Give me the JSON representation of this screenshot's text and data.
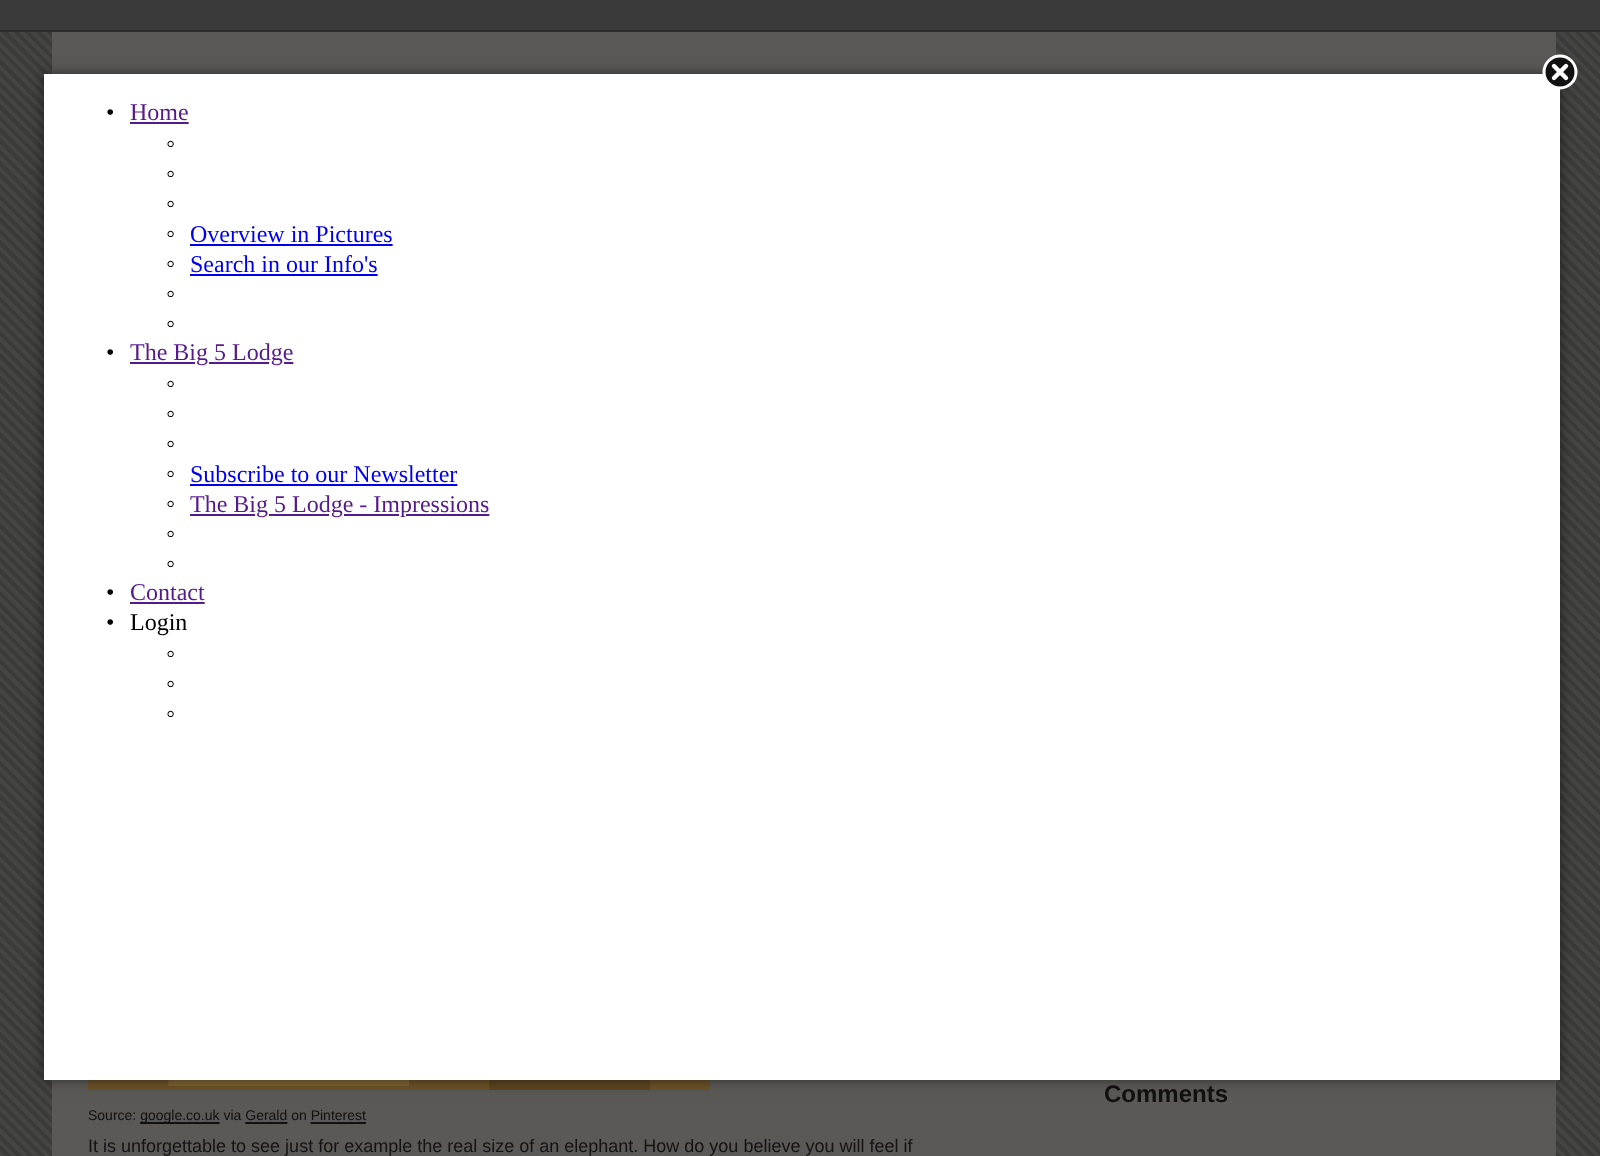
{
  "menu": [
    {
      "marker": "•",
      "label": "Home",
      "kind": "link",
      "visited": true,
      "children": [
        {
          "marker": "◦",
          "kind": "empty"
        },
        {
          "marker": "◦",
          "kind": "empty"
        },
        {
          "marker": "◦",
          "kind": "empty"
        },
        {
          "marker": "◦",
          "kind": "link",
          "label": "Overview in Pictures",
          "visited": false
        },
        {
          "marker": "◦",
          "kind": "link",
          "label": "Search in our Info's",
          "visited": false
        },
        {
          "marker": "◦",
          "kind": "empty"
        },
        {
          "marker": "◦",
          "kind": "empty"
        }
      ]
    },
    {
      "marker": "•",
      "label": "The Big 5 Lodge",
      "kind": "link",
      "visited": true,
      "children": [
        {
          "marker": "◦",
          "kind": "empty"
        },
        {
          "marker": "◦",
          "kind": "empty"
        },
        {
          "marker": "◦",
          "kind": "empty"
        },
        {
          "marker": "◦",
          "kind": "link",
          "label": "Subscribe to our Newsletter",
          "visited": false
        },
        {
          "marker": "◦",
          "kind": "link",
          "label": "The Big 5 Lodge - Impressions",
          "visited": true
        },
        {
          "marker": "◦",
          "kind": "empty"
        },
        {
          "marker": "◦",
          "kind": "empty"
        }
      ]
    },
    {
      "marker": "•",
      "label": "Contact",
      "kind": "link",
      "visited": true
    },
    {
      "marker": "•",
      "label": "Login",
      "kind": "text",
      "children": [
        {
          "marker": "◦",
          "kind": "empty"
        },
        {
          "marker": "◦",
          "kind": "empty"
        },
        {
          "marker": "◦",
          "kind": "empty"
        }
      ]
    }
  ],
  "background": {
    "sidebar_heading": "Comments",
    "caption": [
      {
        "text": "Source: ",
        "kind": "text"
      },
      {
        "text": "google.co.uk",
        "kind": "link"
      },
      {
        "text": " via ",
        "kind": "text"
      },
      {
        "text": "Gerald",
        "kind": "link"
      },
      {
        "text": " on ",
        "kind": "text"
      },
      {
        "text": "Pinterest",
        "kind": "link"
      }
    ],
    "paragraph": "It is unforgettable to see just for example the real size of an elephant. How do you believe you will feel if"
  }
}
